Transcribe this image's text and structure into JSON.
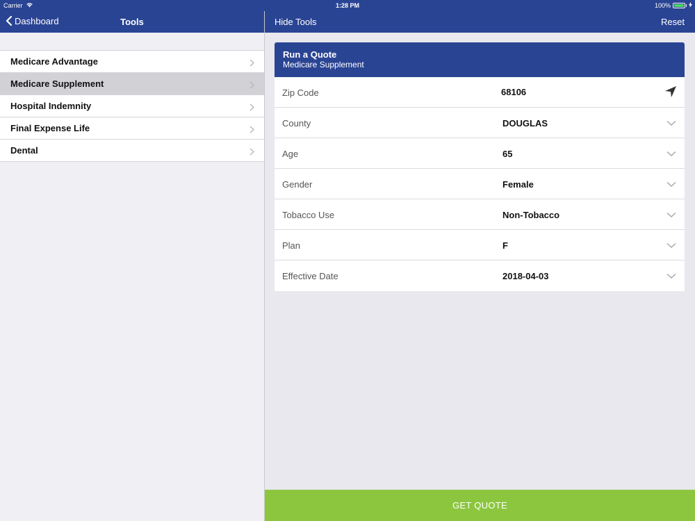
{
  "status_bar": {
    "carrier": "Carrier",
    "time": "1:28 PM",
    "battery": "100%",
    "battery_color": "#4cd964"
  },
  "left_nav": {
    "back_label": "Dashboard",
    "title": "Tools"
  },
  "menu": {
    "items": [
      {
        "label": "Medicare Advantage",
        "selected": false
      },
      {
        "label": "Medicare Supplement",
        "selected": true
      },
      {
        "label": "Hospital Indemnity",
        "selected": false
      },
      {
        "label": "Final Expense Life",
        "selected": false
      },
      {
        "label": "Dental",
        "selected": false
      }
    ]
  },
  "right_nav": {
    "hide_tools_label": "Hide Tools",
    "reset_label": "Reset"
  },
  "quote_card": {
    "title": "Run a Quote",
    "subtitle": "Medicare Supplement",
    "fields": [
      {
        "label": "Zip Code",
        "value": "68106",
        "icon": "location-arrow-icon"
      },
      {
        "label": "County",
        "value": "DOUGLAS",
        "icon": "chevron-down-icon"
      },
      {
        "label": "Age",
        "value": "65",
        "icon": "chevron-down-icon"
      },
      {
        "label": "Gender",
        "value": "Female",
        "icon": "chevron-down-icon"
      },
      {
        "label": "Tobacco Use",
        "value": "Non-Tobacco",
        "icon": "chevron-down-icon"
      },
      {
        "label": "Plan",
        "value": "F",
        "icon": "chevron-down-icon"
      },
      {
        "label": "Effective Date",
        "value": "2018-04-03",
        "icon": "chevron-down-icon"
      }
    ]
  },
  "get_quote_label": "GET QUOTE",
  "colors": {
    "brand_blue": "#2a4494",
    "action_green": "#8cc63f",
    "selected_row": "#d1d1d6",
    "background": "#e8e8ee"
  }
}
